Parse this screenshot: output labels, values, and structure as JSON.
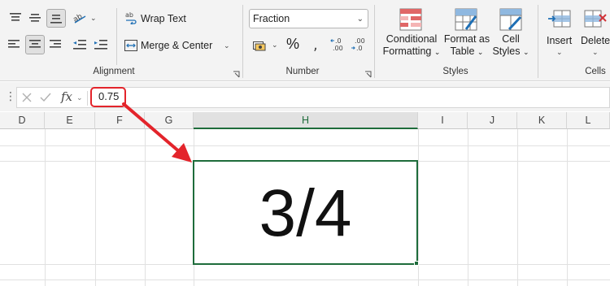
{
  "ribbon": {
    "alignment": {
      "wrap_text_label": "Wrap Text",
      "merge_center_label": "Merge & Center",
      "group_label": "Alignment"
    },
    "number": {
      "format_value": "Fraction",
      "percent_symbol": "%",
      "group_label": "Number"
    },
    "styles": {
      "conditional_formatting_line1": "Conditional",
      "conditional_formatting_line2": "Formatting",
      "format_as_table_line1": "Format as",
      "format_as_table_line2": "Table",
      "cell_styles_line1": "Cell",
      "cell_styles_line2": "Styles",
      "group_label": "Styles"
    },
    "cells": {
      "insert_label": "Insert",
      "delete_label": "Delete",
      "group_label": "Cells"
    }
  },
  "formula_bar": {
    "fx_label": "fx",
    "value": "0.75"
  },
  "columns": [
    "D",
    "E",
    "F",
    "G",
    "H",
    "I",
    "J",
    "K",
    "L"
  ],
  "active_column": "H",
  "active_cell": {
    "display_value": "3/4"
  },
  "colors": {
    "accent_green": "#1e6c3b",
    "highlight_red": "#e3242b"
  }
}
